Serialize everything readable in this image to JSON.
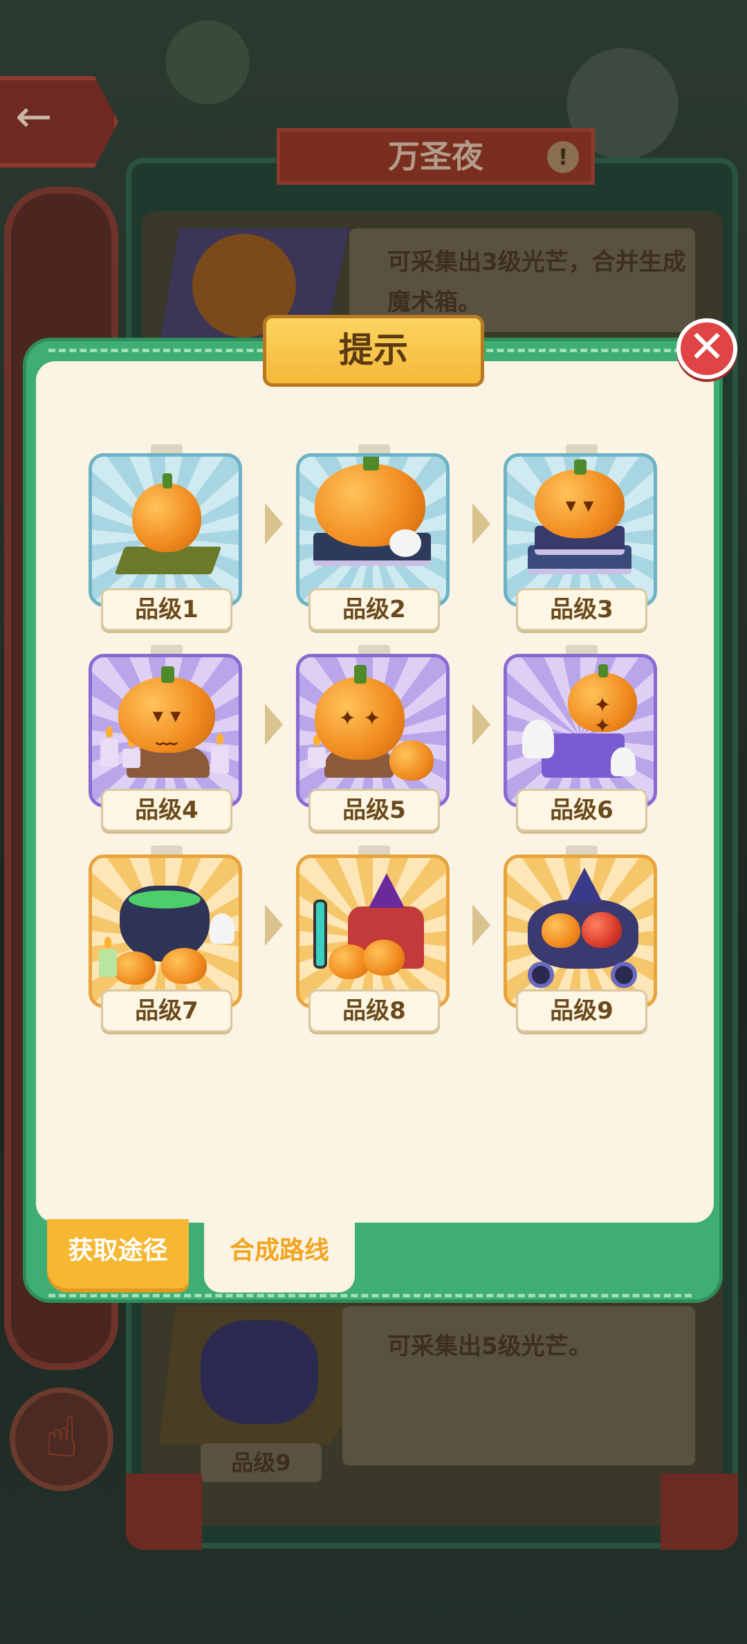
{
  "background": {
    "event_title": "万圣夜",
    "top_description": "可采集出3级光芒，合并生成魔术箱。",
    "bottom_description": "可采集出5级光芒。",
    "bottom_item_label": "品级9"
  },
  "modal": {
    "title": "提示",
    "close_icon": "close-icon",
    "items": [
      {
        "label": "品级1",
        "rarity": "blue"
      },
      {
        "label": "品级2",
        "rarity": "blue"
      },
      {
        "label": "品级3",
        "rarity": "blue"
      },
      {
        "label": "品级4",
        "rarity": "purple"
      },
      {
        "label": "品级5",
        "rarity": "purple"
      },
      {
        "label": "品级6",
        "rarity": "purple"
      },
      {
        "label": "品级7",
        "rarity": "orange"
      },
      {
        "label": "品级8",
        "rarity": "orange"
      },
      {
        "label": "品级9",
        "rarity": "orange"
      }
    ],
    "tabs": [
      {
        "label": "获取途径",
        "active": false
      },
      {
        "label": "合成路线",
        "active": true
      }
    ]
  },
  "colors": {
    "modal_frame": "#3fae74",
    "paper": "#fbf3e3",
    "close": "#e04444",
    "title_ribbon": "#f5b83a",
    "tab_active_text": "#f0a520"
  }
}
